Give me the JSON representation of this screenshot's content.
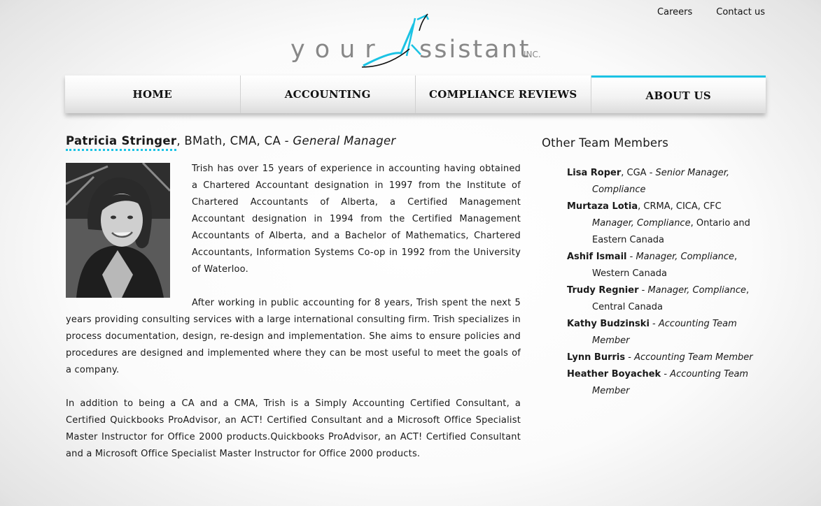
{
  "header": {
    "links": [
      "Careers",
      "Contact us"
    ],
    "logo": {
      "word1": "your",
      "word2": "ssistant",
      "suffix": "INC."
    }
  },
  "nav": {
    "items": [
      "HOME",
      "ACCOUNTING",
      "COMPLIANCE REVIEWS",
      "ABOUT US"
    ],
    "active": "ABOUT US"
  },
  "profile": {
    "name": "Patricia Stringer",
    "credentials": ", BMath, CMA, CA - ",
    "title": "General Manager",
    "paragraphs": [
      "Trish has over 15 years of experience in accounting having obtained a Chartered Accountant designation in 1997 from the Institute of Chartered Accountants of Alberta, a Certified Management Accountant designation in 1994 from the Certified Management Accountants of Alberta, and a Bachelor of Mathematics, Chartered Accountants, Information Systems Co-op in 1992 from the University of Waterloo.",
      "After working in public accounting for 8 years, Trish spent the next 5 years providing consulting services with a large international consulting firm. Trish specializes in process documentation, design, re-design and implementation. She aims to ensure policies and procedures are designed and implemented where they can be most useful to meet the goals of a company.",
      "In addition to being a CA and a CMA, Trish is a Simply Accounting Certified Consultant, a Certified Quickbooks ProAdvisor, an ACT! Certified Consultant and a Microsoft Office Specialist Master Instructor for Office 2000 products.Quickbooks ProAdvisor, an ACT! Certified Consultant and a Microsoft Office Specialist Master Instructor for Office 2000 products."
    ]
  },
  "team": {
    "heading": "Other Team Members",
    "members": [
      {
        "name": "Lisa Roper",
        "sep": ", CGA - ",
        "title": "Senior Manager, Compliance",
        "tail": ""
      },
      {
        "name": "Murtaza Lotia",
        "sep": ", CRMA, CICA, CFC ",
        "title": "Manager, Compliance",
        "tail": ", Ontario and Eastern Canada"
      },
      {
        "name": "Ashif Ismail",
        "sep": " - ",
        "title": "Manager, Compliance",
        "tail": ", Western Canada"
      },
      {
        "name": "Trudy Regnier",
        "sep": " - ",
        "title": "Manager, Compliance",
        "tail": ", Central Canada"
      },
      {
        "name": "Kathy Budzinski",
        "sep": " - ",
        "title": "Accounting Team Member",
        "tail": ""
      },
      {
        "name": "Lynn Burris",
        "sep": " - ",
        "title": "Accounting Team Member",
        "tail": ""
      },
      {
        "name": "Heather Boyachek",
        "sep": " - ",
        "title": "Accounting Team Member",
        "tail": ""
      }
    ]
  },
  "colors": {
    "accent": "#1bc3e4",
    "text": "#1a1a1a",
    "logo_gray": "#888888"
  },
  "icons": {
    "photo": "portrait-photo",
    "logo_mark": "arrow-a-icon"
  }
}
